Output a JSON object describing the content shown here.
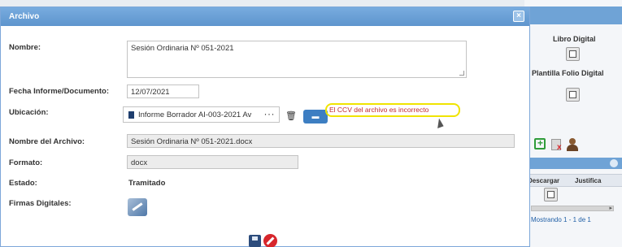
{
  "modal": {
    "title": "Archivo",
    "close_symbol": "×"
  },
  "form": {
    "nombre_label": "Nombre:",
    "nombre_value": "Sesión Ordinaria Nº 051-2021",
    "fecha_label": "Fecha Informe/Documento:",
    "fecha_value": "12/07/2021",
    "ubicacion_label": "Ubicación:",
    "ubicacion_file": "Informe Borrador AI-003-2021 Av",
    "ubicacion_more": "···",
    "error_message": "El CCV del archivo es incorrecto",
    "nombre_archivo_label": "Nombre del Archivo:",
    "nombre_archivo_value": "Sesión Ordinaria Nº 051-2021.docx",
    "formato_label": "Formato:",
    "formato_value": "docx",
    "estado_label": "Estado:",
    "estado_value": "Tramitado",
    "firmas_label": "Firmas Digitales:"
  },
  "background": {
    "libro_digital": "Libro Digital",
    "plantilla_folio": "Plantilla Folio Digital",
    "col_descargar": "Descargar",
    "col_justifica": "Justifica",
    "footer_text": "Mostrando 1 - 1 de 1"
  },
  "icons": {
    "trash": "trash-icon",
    "folder": "folder-open-icon",
    "signature": "signature-pen-icon",
    "save": "save-icon",
    "cancel": "cancel-icon",
    "file": "file-icon"
  },
  "colors": {
    "title_bar": "#5e95cd",
    "error_text": "#c0282e",
    "highlight": "#f0e400",
    "primary_button": "#3d7ec2"
  }
}
